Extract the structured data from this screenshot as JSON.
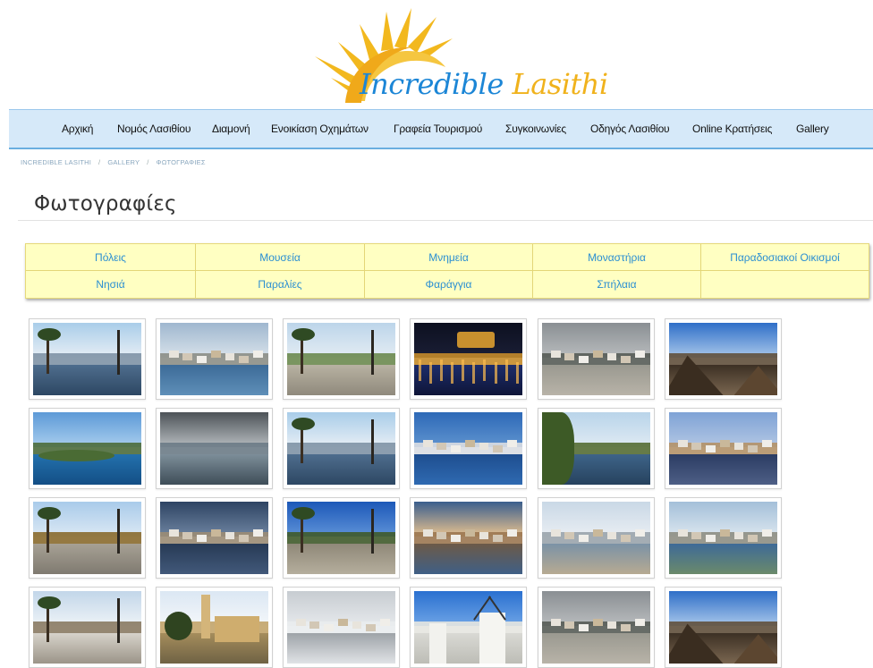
{
  "logo": {
    "word1": "Incredible",
    "word2": "Lasithi",
    "sun_color": "#f2b81e",
    "text_blue": "#1c86d6"
  },
  "nav": {
    "items": [
      "Αρχική",
      "Νομός Λασιθίου",
      "Διαμονή",
      "Ενοικίαση Οχημάτων",
      "Γραφεία Τουρισμού",
      "Συγκοινωνίες",
      "Οδηγός Λασιθίου",
      "Online Κρατήσεις",
      "Gallery"
    ]
  },
  "breadcrumb": {
    "items": [
      "INCREDIBLE LASITHI",
      "GALLERY",
      "ΦΩΤΟΓΡΑΦΙΕΣ"
    ],
    "separator": "/"
  },
  "page": {
    "title": "Φωτογραφίες"
  },
  "categories": {
    "row1": [
      "Πόλεις",
      "Μουσεία",
      "Μνημεία",
      "Μοναστήρια",
      "Παραδοσιακοί Οικισμοί"
    ],
    "row2": [
      "Νησιά",
      "Παραλίες",
      "Φαράγγια",
      "Σπήλαια",
      ""
    ]
  },
  "gallery": {
    "photos": [
      {
        "scene": "harbor-palms"
      },
      {
        "scene": "town-bay"
      },
      {
        "scene": "palm-promenade"
      },
      {
        "scene": "night-harbor"
      },
      {
        "scene": "town-hills-cloudy"
      },
      {
        "scene": "mountain-sunrise"
      },
      {
        "scene": "island-sea"
      },
      {
        "scene": "stormy-sea"
      },
      {
        "scene": "harbor-palms"
      },
      {
        "scene": "lake-town-blue"
      },
      {
        "scene": "lake-trees"
      },
      {
        "scene": "evening-harbor"
      },
      {
        "scene": "palm-promenade-sunny"
      },
      {
        "scene": "town-dusk"
      },
      {
        "scene": "palms-blue-sky"
      },
      {
        "scene": "town-sunset"
      },
      {
        "scene": "beach-town"
      },
      {
        "scene": "town-bay-wide"
      },
      {
        "scene": "seaside-cafe"
      },
      {
        "scene": "church-minaret"
      },
      {
        "scene": "snowy-village"
      },
      {
        "scene": "windmills"
      },
      {
        "scene": "town-hills-cloudy"
      },
      {
        "scene": "mountain-sunrise"
      }
    ]
  }
}
